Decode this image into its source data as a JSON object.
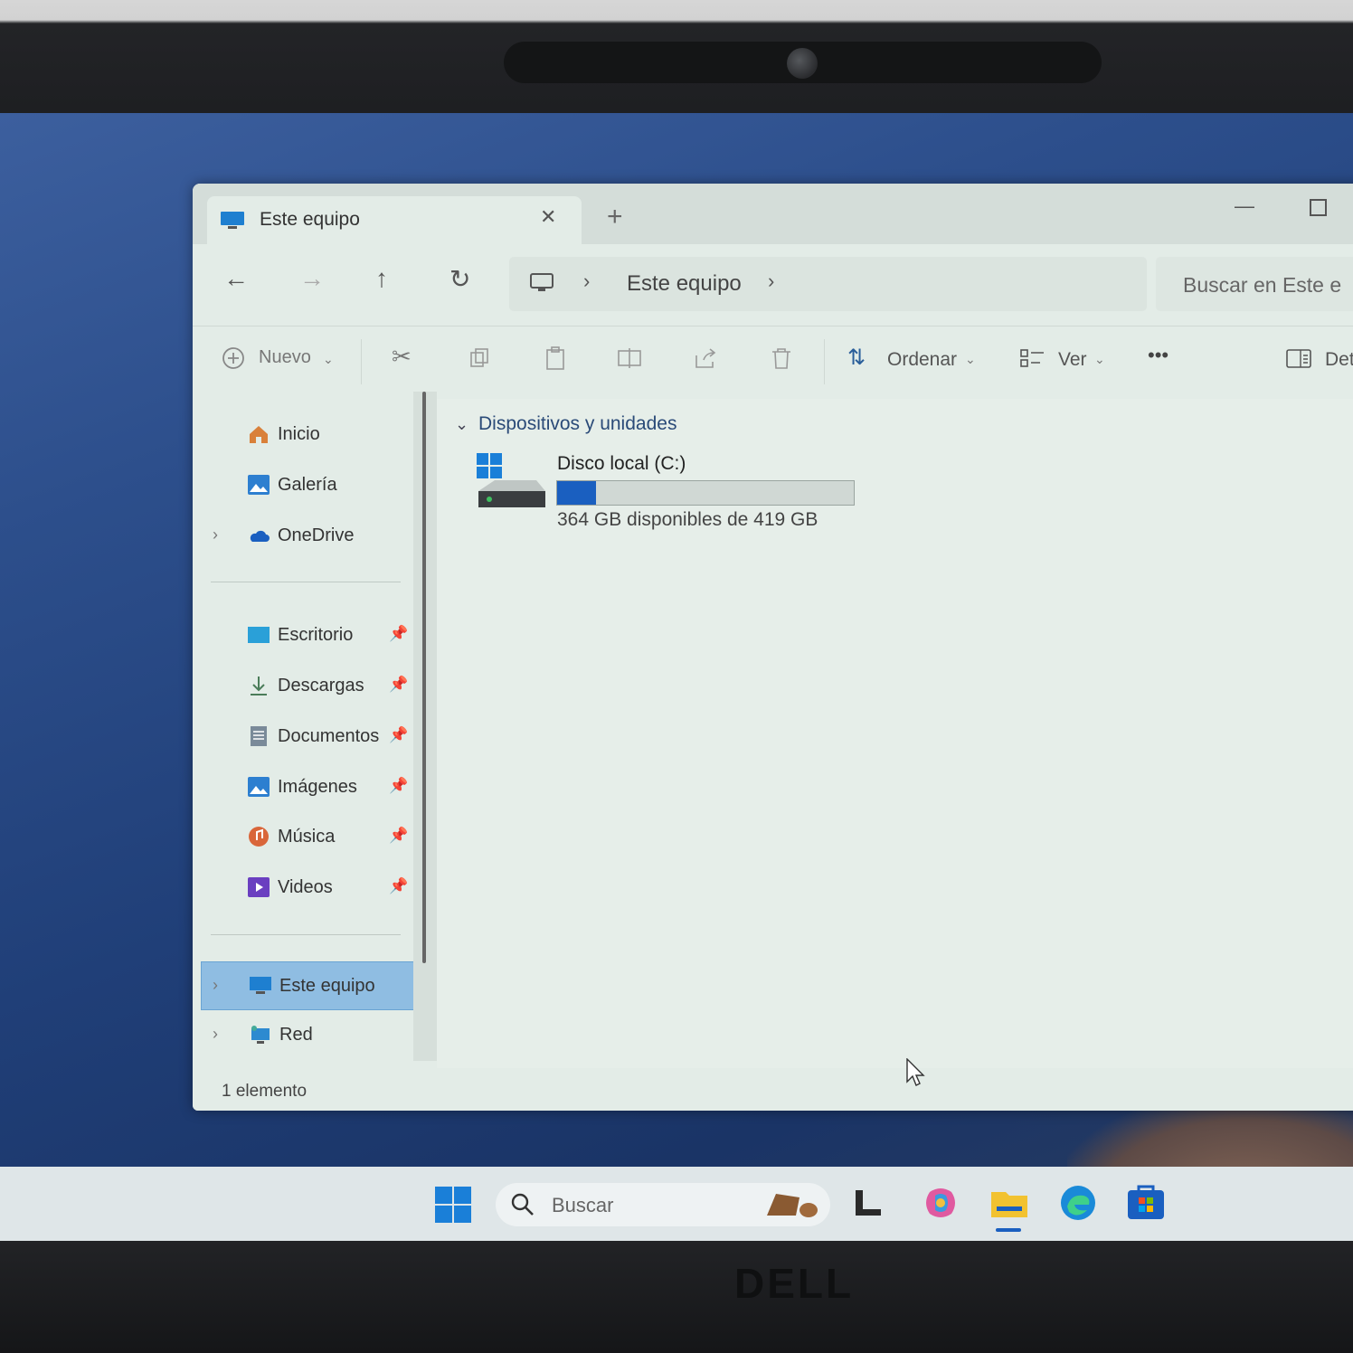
{
  "tab": {
    "title": "Este equipo"
  },
  "address": {
    "path": "Este equipo"
  },
  "search": {
    "placeholder": "Buscar en Este e"
  },
  "toolbar": {
    "new_label": "Nuevo",
    "sort_label": "Ordenar",
    "view_label": "Ver",
    "more_label": "•••",
    "details_label": "Det"
  },
  "sidebar": {
    "items": [
      {
        "label": "Inicio",
        "icon": "home-icon"
      },
      {
        "label": "Galería",
        "icon": "gallery-icon"
      },
      {
        "label": "OneDrive",
        "icon": "cloud-icon"
      },
      {
        "label": "Escritorio",
        "icon": "desktop-icon"
      },
      {
        "label": "Descargas",
        "icon": "download-icon"
      },
      {
        "label": "Documentos",
        "icon": "document-icon"
      },
      {
        "label": "Imágenes",
        "icon": "pictures-icon"
      },
      {
        "label": "Música",
        "icon": "music-icon"
      },
      {
        "label": "Videos",
        "icon": "video-icon"
      },
      {
        "label": "Este equipo",
        "icon": "computer-icon"
      },
      {
        "label": "Red",
        "icon": "network-icon"
      }
    ]
  },
  "content": {
    "group_title": "Dispositivos y unidades",
    "drive": {
      "name": "Disco local (C:)",
      "free_text": "364 GB disponibles de 419 GB",
      "used_fraction": 0.13
    }
  },
  "status": {
    "count": "1 elemento"
  },
  "taskbar": {
    "search_placeholder": "Buscar"
  },
  "bezel": {
    "brand": "DELL"
  },
  "colors": {
    "accent": "#1a5fc0",
    "selection": "#8fbde2"
  }
}
